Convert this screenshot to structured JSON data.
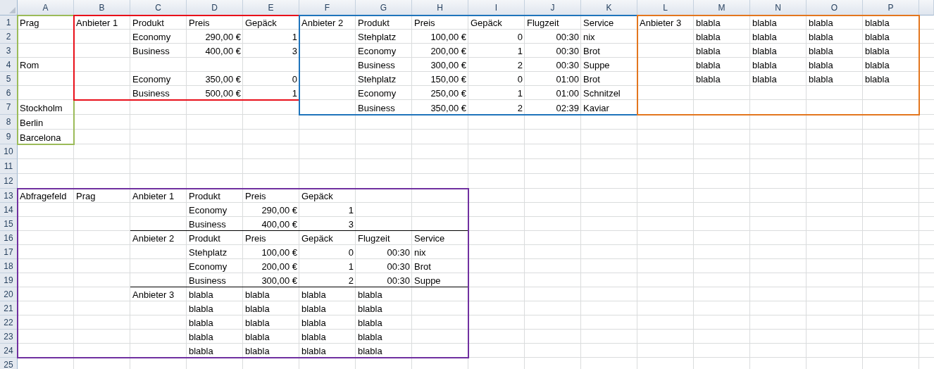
{
  "columns": [
    "A",
    "B",
    "C",
    "D",
    "E",
    "F",
    "G",
    "H",
    "I",
    "J",
    "K",
    "L",
    "M",
    "N",
    "O",
    "P"
  ],
  "rows": [
    {
      "number": "1",
      "cells": [
        {
          "text": "Prag",
          "kind": "text"
        },
        {
          "text": "Anbieter 1",
          "kind": "text"
        },
        {
          "text": "Produkt",
          "kind": "text"
        },
        {
          "text": "Preis",
          "kind": "text"
        },
        {
          "text": "Gepäck",
          "kind": "text"
        },
        {
          "text": "Anbieter 2",
          "kind": "text"
        },
        {
          "text": "Produkt",
          "kind": "text"
        },
        {
          "text": "Preis",
          "kind": "text"
        },
        {
          "text": "Gepäck",
          "kind": "text"
        },
        {
          "text": "Flugzeit",
          "kind": "text"
        },
        {
          "text": "Service",
          "kind": "text"
        },
        {
          "text": "Anbieter 3",
          "kind": "text"
        },
        {
          "text": "blabla",
          "kind": "text"
        },
        {
          "text": "blabla",
          "kind": "text"
        },
        {
          "text": "blabla",
          "kind": "text"
        },
        {
          "text": "blabla",
          "kind": "text"
        }
      ]
    },
    {
      "number": "2",
      "cells": [
        null,
        null,
        {
          "text": "Economy",
          "kind": "text"
        },
        {
          "text": "290,00 €",
          "kind": "number"
        },
        {
          "text": "1",
          "kind": "number"
        },
        null,
        {
          "text": "Stehplatz",
          "kind": "text"
        },
        {
          "text": "100,00 €",
          "kind": "number"
        },
        {
          "text": "0",
          "kind": "number"
        },
        {
          "text": "00:30",
          "kind": "number"
        },
        {
          "text": "nix",
          "kind": "text"
        },
        null,
        {
          "text": "blabla",
          "kind": "text"
        },
        {
          "text": "blabla",
          "kind": "text"
        },
        {
          "text": "blabla",
          "kind": "text"
        },
        {
          "text": "blabla",
          "kind": "text"
        }
      ]
    },
    {
      "number": "3",
      "cells": [
        null,
        null,
        {
          "text": "Business",
          "kind": "text"
        },
        {
          "text": "400,00 €",
          "kind": "number"
        },
        {
          "text": "3",
          "kind": "number"
        },
        null,
        {
          "text": "Economy",
          "kind": "text"
        },
        {
          "text": "200,00 €",
          "kind": "number"
        },
        {
          "text": "1",
          "kind": "number"
        },
        {
          "text": "00:30",
          "kind": "number"
        },
        {
          "text": "Brot",
          "kind": "text"
        },
        null,
        {
          "text": "blabla",
          "kind": "text"
        },
        {
          "text": "blabla",
          "kind": "text"
        },
        {
          "text": "blabla",
          "kind": "text"
        },
        {
          "text": "blabla",
          "kind": "text"
        }
      ]
    },
    {
      "number": "4",
      "cells": [
        {
          "text": "Rom",
          "kind": "text"
        },
        null,
        null,
        null,
        null,
        null,
        {
          "text": "Business",
          "kind": "text"
        },
        {
          "text": "300,00 €",
          "kind": "number"
        },
        {
          "text": "2",
          "kind": "number"
        },
        {
          "text": "00:30",
          "kind": "number"
        },
        {
          "text": "Suppe",
          "kind": "text"
        },
        null,
        {
          "text": "blabla",
          "kind": "text"
        },
        {
          "text": "blabla",
          "kind": "text"
        },
        {
          "text": "blabla",
          "kind": "text"
        },
        {
          "text": "blabla",
          "kind": "text"
        }
      ]
    },
    {
      "number": "5",
      "cells": [
        null,
        null,
        {
          "text": "Economy",
          "kind": "text"
        },
        {
          "text": "350,00 €",
          "kind": "number"
        },
        {
          "text": "0",
          "kind": "number"
        },
        null,
        {
          "text": "Stehplatz",
          "kind": "text"
        },
        {
          "text": "150,00 €",
          "kind": "number"
        },
        {
          "text": "0",
          "kind": "number"
        },
        {
          "text": "01:00",
          "kind": "number"
        },
        {
          "text": "Brot",
          "kind": "text"
        },
        null,
        {
          "text": "blabla",
          "kind": "text"
        },
        {
          "text": "blabla",
          "kind": "text"
        },
        {
          "text": "blabla",
          "kind": "text"
        },
        {
          "text": "blabla",
          "kind": "text"
        }
      ]
    },
    {
      "number": "6",
      "cells": [
        null,
        null,
        {
          "text": "Business",
          "kind": "text"
        },
        {
          "text": "500,00 €",
          "kind": "number"
        },
        {
          "text": "1",
          "kind": "number"
        },
        null,
        {
          "text": "Economy",
          "kind": "text"
        },
        {
          "text": "250,00 €",
          "kind": "number"
        },
        {
          "text": "1",
          "kind": "number"
        },
        {
          "text": "01:00",
          "kind": "number"
        },
        {
          "text": "Schnitzel",
          "kind": "text"
        }
      ]
    },
    {
      "number": "7",
      "cells": [
        {
          "text": "Stockholm",
          "kind": "text"
        },
        null,
        null,
        null,
        null,
        null,
        {
          "text": "Business",
          "kind": "text"
        },
        {
          "text": "350,00 €",
          "kind": "number"
        },
        {
          "text": "2",
          "kind": "number"
        },
        {
          "text": "02:39",
          "kind": "number"
        },
        {
          "text": "Kaviar",
          "kind": "text"
        }
      ]
    },
    {
      "number": "8",
      "cells": [
        {
          "text": "Berlin",
          "kind": "text"
        }
      ]
    },
    {
      "number": "9",
      "cells": [
        {
          "text": "Barcelona",
          "kind": "text"
        }
      ]
    },
    {
      "number": "10"
    },
    {
      "number": "11"
    },
    {
      "number": "12"
    },
    {
      "number": "13",
      "cells": [
        {
          "text": "Abfragefeld",
          "kind": "text"
        },
        {
          "text": "Prag",
          "kind": "text"
        },
        {
          "text": "Anbieter 1",
          "kind": "text"
        },
        {
          "text": "Produkt",
          "kind": "text"
        },
        {
          "text": "Preis",
          "kind": "text"
        },
        {
          "text": "Gepäck",
          "kind": "text"
        }
      ]
    },
    {
      "number": "14",
      "cells": [
        null,
        null,
        null,
        {
          "text": "Economy",
          "kind": "text"
        },
        {
          "text": "290,00 €",
          "kind": "number"
        },
        {
          "text": "1",
          "kind": "number"
        }
      ]
    },
    {
      "number": "15",
      "cells": [
        null,
        null,
        null,
        {
          "text": "Business",
          "kind": "text"
        },
        {
          "text": "400,00 €",
          "kind": "number"
        },
        {
          "text": "3",
          "kind": "number"
        }
      ]
    },
    {
      "number": "16",
      "cells": [
        null,
        null,
        {
          "text": "Anbieter 2",
          "kind": "text"
        },
        {
          "text": "Produkt",
          "kind": "text"
        },
        {
          "text": "Preis",
          "kind": "text"
        },
        {
          "text": "Gepäck",
          "kind": "text"
        },
        {
          "text": "Flugzeit",
          "kind": "text"
        },
        {
          "text": "Service",
          "kind": "text"
        }
      ]
    },
    {
      "number": "17",
      "cells": [
        null,
        null,
        null,
        {
          "text": "Stehplatz",
          "kind": "text"
        },
        {
          "text": "100,00 €",
          "kind": "number"
        },
        {
          "text": "0",
          "kind": "number"
        },
        {
          "text": "00:30",
          "kind": "number"
        },
        {
          "text": "nix",
          "kind": "text"
        }
      ]
    },
    {
      "number": "18",
      "cells": [
        null,
        null,
        null,
        {
          "text": "Economy",
          "kind": "text"
        },
        {
          "text": "200,00 €",
          "kind": "number"
        },
        {
          "text": "1",
          "kind": "number"
        },
        {
          "text": "00:30",
          "kind": "number"
        },
        {
          "text": "Brot",
          "kind": "text"
        }
      ]
    },
    {
      "number": "19",
      "cells": [
        null,
        null,
        null,
        {
          "text": "Business",
          "kind": "text"
        },
        {
          "text": "300,00 €",
          "kind": "number"
        },
        {
          "text": "2",
          "kind": "number"
        },
        {
          "text": "00:30",
          "kind": "number"
        },
        {
          "text": "Suppe",
          "kind": "text"
        }
      ]
    },
    {
      "number": "20",
      "cells": [
        null,
        null,
        {
          "text": "Anbieter 3",
          "kind": "text"
        },
        {
          "text": "blabla",
          "kind": "text"
        },
        {
          "text": "blabla",
          "kind": "text"
        },
        {
          "text": "blabla",
          "kind": "text"
        },
        {
          "text": "blabla",
          "kind": "text"
        }
      ]
    },
    {
      "number": "21",
      "cells": [
        null,
        null,
        null,
        {
          "text": "blabla",
          "kind": "text"
        },
        {
          "text": "blabla",
          "kind": "text"
        },
        {
          "text": "blabla",
          "kind": "text"
        },
        {
          "text": "blabla",
          "kind": "text"
        }
      ]
    },
    {
      "number": "22",
      "cells": [
        null,
        null,
        null,
        {
          "text": "blabla",
          "kind": "text"
        },
        {
          "text": "blabla",
          "kind": "text"
        },
        {
          "text": "blabla",
          "kind": "text"
        },
        {
          "text": "blabla",
          "kind": "text"
        }
      ]
    },
    {
      "number": "23",
      "cells": [
        null,
        null,
        null,
        {
          "text": "blabla",
          "kind": "text"
        },
        {
          "text": "blabla",
          "kind": "text"
        },
        {
          "text": "blabla",
          "kind": "text"
        },
        {
          "text": "blabla",
          "kind": "text"
        }
      ]
    },
    {
      "number": "24",
      "cells": [
        null,
        null,
        null,
        {
          "text": "blabla",
          "kind": "text"
        },
        {
          "text": "blabla",
          "kind": "text"
        },
        {
          "text": "blabla",
          "kind": "text"
        },
        {
          "text": "blabla",
          "kind": "text"
        }
      ]
    },
    {
      "number": "25"
    }
  ],
  "outlines": [
    {
      "color": "#9bbb59"
    },
    {
      "color": "#e8101a"
    },
    {
      "color": "#1f74bb"
    },
    {
      "color": "#e3761e"
    },
    {
      "color": "#7030a0"
    }
  ]
}
